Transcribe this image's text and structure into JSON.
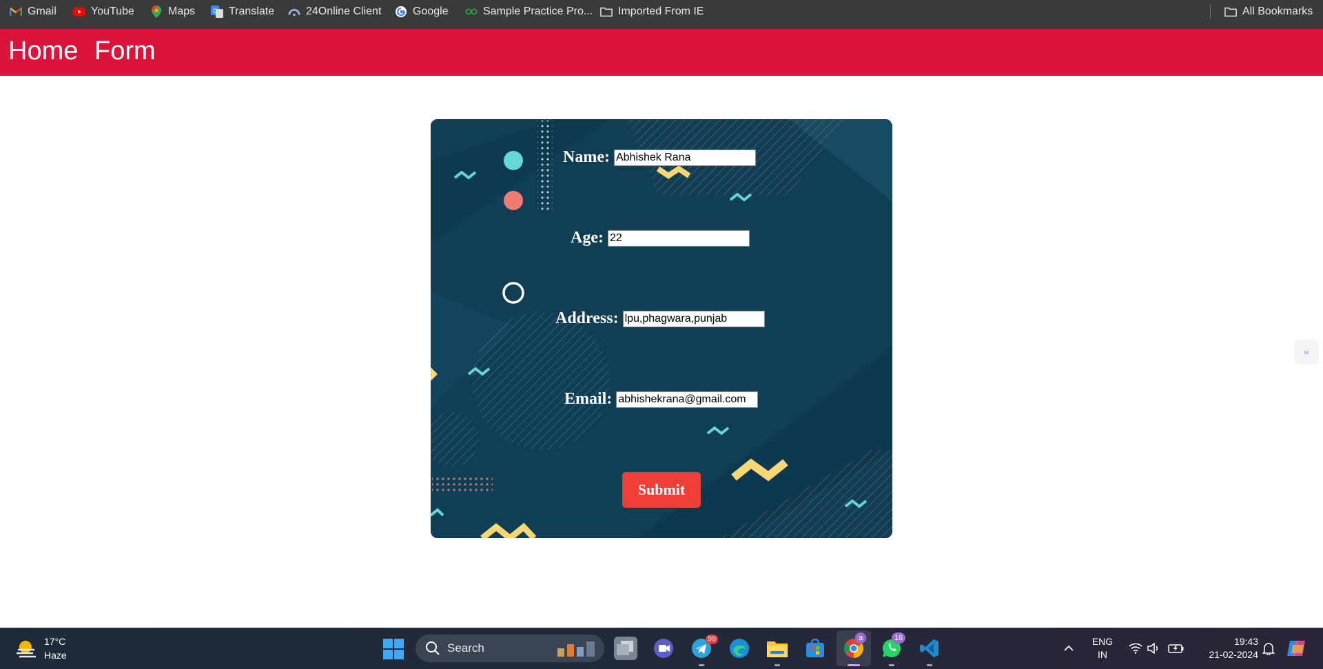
{
  "bookmarks": {
    "items": [
      {
        "label": "Gmail",
        "icon": "gmail-icon"
      },
      {
        "label": "YouTube",
        "icon": "youtube-icon"
      },
      {
        "label": "Maps",
        "icon": "maps-icon"
      },
      {
        "label": "Translate",
        "icon": "translate-icon"
      },
      {
        "label": "24Online Client",
        "icon": "24online-icon"
      },
      {
        "label": "Google",
        "icon": "google-icon"
      },
      {
        "label": "Sample Practice Pro...",
        "icon": "practice-icon"
      },
      {
        "label": "Imported From IE",
        "icon": "folder-icon"
      }
    ],
    "all_bookmarks": "All Bookmarks"
  },
  "nav": {
    "home": "Home",
    "form": "Form",
    "color": "#dc143c"
  },
  "form": {
    "name_label": "Name:",
    "name_value": "Abhishek Rana",
    "age_label": "Age:",
    "age_value": "22",
    "address_label": "Address:",
    "address_value": "lpu,phagwara,punjab",
    "email_label": "Email:",
    "email_value": "abhishekrana@gmail.com",
    "submit_label": "Submit",
    "background_color": "#103e55",
    "button_color": "#ef3e36"
  },
  "side_widget": {
    "glyph": "›‹"
  },
  "taskbar": {
    "weather_temp": "17°C",
    "weather_desc": "Haze",
    "search_label": "Search",
    "telegram_badge": "99",
    "whatsapp_badge": "16",
    "chrome_badge": "a",
    "language_line1": "ENG",
    "language_line2": "IN",
    "time": "19:43",
    "date": "21-02-2024"
  }
}
